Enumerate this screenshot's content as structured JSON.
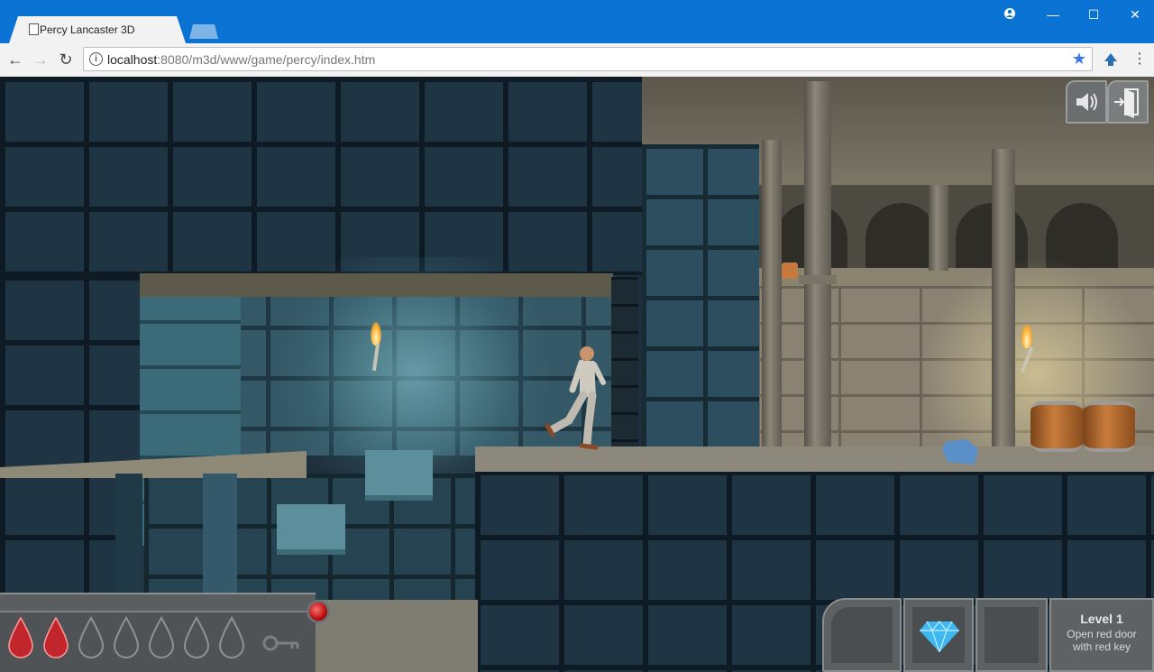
{
  "browser": {
    "tab_title": "Percy Lancaster 3D",
    "url_host": "localhost",
    "url_rest": ":8080/m3d/www/game/percy/index.htm",
    "window_buttons": [
      "—",
      "☐",
      "✕"
    ]
  },
  "game": {
    "hud": {
      "health": {
        "filled": 2,
        "total": 7
      },
      "inventory": [
        "empty",
        "blue-diamond",
        "empty"
      ],
      "level_title": "Level 1",
      "objective_line1": "Open red door",
      "objective_line2": "with red key"
    },
    "colors": {
      "health_drop": "#c0262c",
      "diamond": "#3fb7f0",
      "alarm_gem": "#d01818"
    }
  }
}
